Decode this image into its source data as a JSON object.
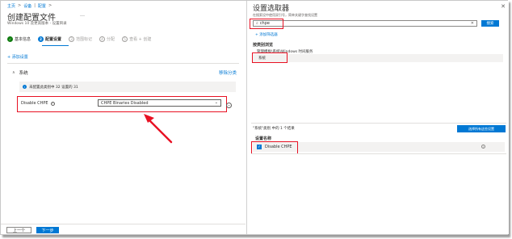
{
  "breadcrumb": [
    "主页",
    "设备",
    "配置"
  ],
  "page": {
    "title": "创建配置文件",
    "subtitle": "Windows 10 及更高版本 - 设置目录",
    "more": "…"
  },
  "steps": [
    {
      "num": "✓",
      "label": "基本信息",
      "state": "done"
    },
    {
      "num": "2",
      "label": "配置设置",
      "state": "active"
    },
    {
      "num": "3",
      "label": "范围标记",
      "state": "todo"
    },
    {
      "num": "4",
      "label": "分配",
      "state": "todo"
    },
    {
      "num": "5",
      "label": "查看 + 创建",
      "state": "todo"
    }
  ],
  "add_setting": "+ 添加设置",
  "section": {
    "chevron": "∧",
    "name": "系统",
    "remove": "移除分类"
  },
  "info_bar": {
    "icon": "i",
    "text": "未配置此类别中 32 设置的 31"
  },
  "setting": {
    "label": "Disable CHPE",
    "info": "i",
    "value": "CHPE Binaries Disabled",
    "caret": "⌄",
    "minus": "−"
  },
  "footer": {
    "prev": "上一个",
    "next": "下一步"
  },
  "picker": {
    "title": "设置选取器",
    "close": "✕",
    "hint": "在搜索设中使用双引号，简单关键字查找设置",
    "search_value": "chpe",
    "search_icon": "⌕",
    "clear": "✕",
    "search_button": "搜索",
    "add_filter": "+ 添加筛选器",
    "browse_heading": "按类别浏览",
    "categories": [
      "管理模板\\系统\\Windows 时间服务",
      "系统"
    ],
    "results_count": "\"系统\"类别 中的 1 个结果",
    "select_all": "选择所有这些设置",
    "column_header": "设置名称",
    "result": {
      "checked": "✓",
      "label": "Disable CHPE",
      "info": "i"
    }
  },
  "colors": {
    "accent": "#0078d4",
    "highlight": "#e81123",
    "done": "#107c10"
  }
}
